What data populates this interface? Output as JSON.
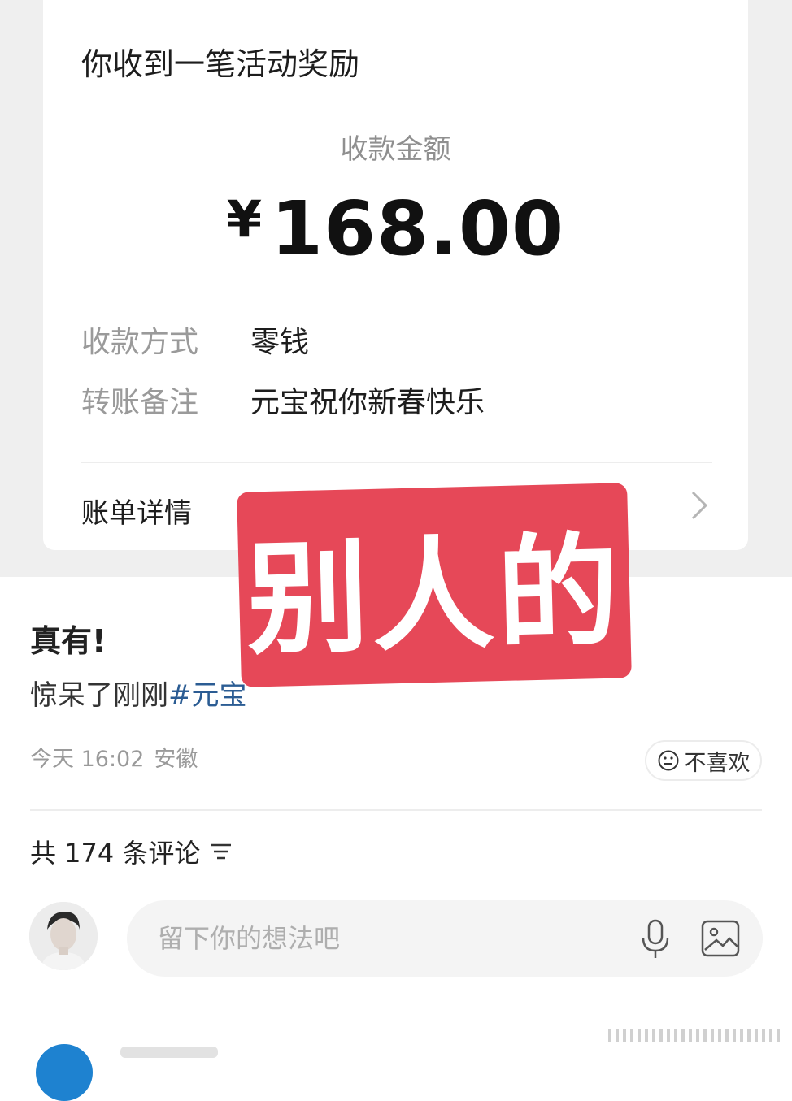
{
  "card": {
    "title": "你收到一笔活动奖励",
    "amount_label": "收款金额",
    "currency": "¥",
    "amount": "168.00",
    "rows": [
      {
        "label": "收款方式",
        "value": "零钱"
      },
      {
        "label": "转账备注",
        "value": "元宝祝你新春快乐"
      }
    ],
    "bill_details": "账单详情"
  },
  "overlay": {
    "text": "别人的"
  },
  "post": {
    "title": "真有!",
    "text": "惊呆了刚刚",
    "hashtag": "#元宝",
    "time": "今天 16:02",
    "location": "安徽",
    "dislike_label": "不喜欢"
  },
  "comments": {
    "header": "共 174 条评论",
    "input_placeholder": "留下你的想法吧"
  },
  "colors": {
    "overlay_bg": "#e64858",
    "hashtag": "#2b5c93",
    "page_top_bg": "#efefef"
  },
  "icons": [
    "chevron-right-icon",
    "neutral-face-icon",
    "sort-lines-icon",
    "microphone-icon",
    "image-icon"
  ]
}
